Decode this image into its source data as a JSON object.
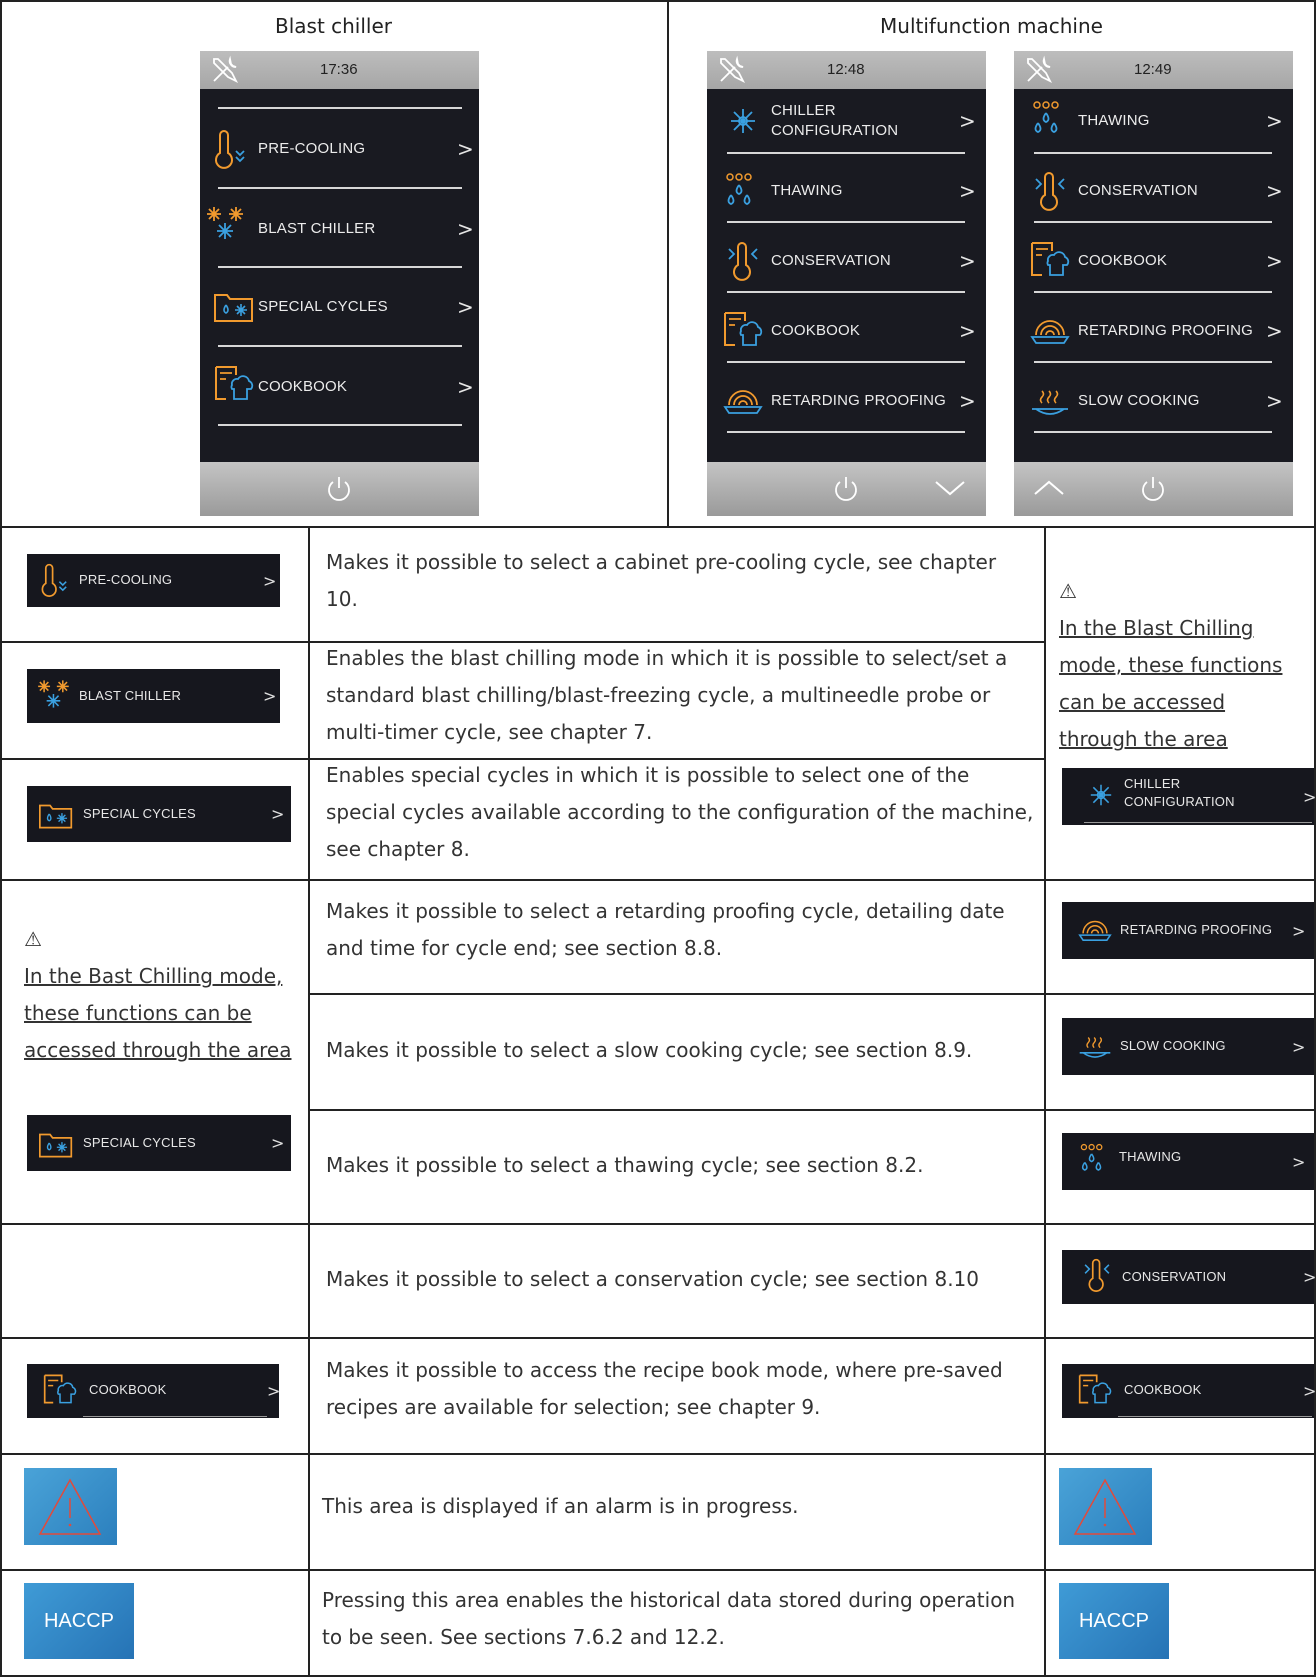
{
  "headers": {
    "blast_chiller": "Blast chiller",
    "multifunction": "Multifunction machine"
  },
  "screens": {
    "blast": {
      "time": "17:36",
      "items": [
        "PRE-COOLING",
        "BLAST CHILLER",
        "SPECIAL CYCLES",
        "COOKBOOK"
      ]
    },
    "multi1": {
      "time": "12:48",
      "items": [
        "CHILLER",
        "CONFIGURATION",
        "THAWING",
        "CONSERVATION",
        "COOKBOOK",
        "RETARDING PROOFING"
      ]
    },
    "multi2": {
      "time": "12:49",
      "items": [
        "THAWING",
        "CONSERVATION",
        "COOKBOOK",
        "RETARDING PROOFING",
        "SLOW COOKING"
      ]
    }
  },
  "arrow_glyph": ">",
  "warning_glyph": "⚠",
  "rows": {
    "precooling": {
      "button": "PRE-COOLING",
      "desc": "Makes it possible to select a cabinet pre-cooling cycle, see chapter 10."
    },
    "blast": {
      "button": "BLAST CHILLER",
      "desc": "Enables the blast chilling mode in which it is possible to select/set a standard blast chilling/blast-freezing cycle, a multineedle probe or multi-timer cycle, see chapter 7."
    },
    "special": {
      "button": "SPECIAL CYCLES",
      "desc": "Enables special cycles in which it is possible to select one of the special cycles available according to the configuration of the machine, see chapter 8."
    },
    "retarding": {
      "button": "RETARDING PROOFING",
      "desc": "Makes it possible to select a retarding proofing cycle, detailing date and time for cycle end; see section 8.8."
    },
    "slow": {
      "button": "SLOW COOKING",
      "desc": "Makes it possible to select a slow cooking cycle; see section 8.9."
    },
    "thawing": {
      "button": "THAWING",
      "desc": "Makes it possible to select a thawing cycle; see section 8.2."
    },
    "conservation": {
      "button": "CONSERVATION",
      "desc": "Makes it possible to select a conservation cycle; see section 8.10"
    },
    "cookbook": {
      "button": "COOKBOOK",
      "desc": "Makes it possible to access the recipe book mode, where pre-saved recipes are available for selection; see chapter 9."
    },
    "alarm": {
      "desc": "This area is displayed if an alarm is in progress."
    },
    "haccp": {
      "label": "HACCP",
      "desc": "Pressing this area enables the historical data stored during operation to be seen. See sections 7.6.2 and 12.2."
    }
  },
  "notes": {
    "right": {
      "text": "In the Blast Chilling mode, these functions can be accessed through the area",
      "button_line1": "CHILLER",
      "button_line2": "CONFIGURATION"
    },
    "left": {
      "text": "In the Bast Chilling mode, these functions can be accessed through the area",
      "button": "SPECIAL CYCLES"
    }
  },
  "colors": {
    "screen_bg": "#191a21",
    "icon_orange": "#f19a2e",
    "icon_blue": "#3aa0e0",
    "alarm_bg": "#3a92cc",
    "haccp_bg": "#2f86c6"
  }
}
